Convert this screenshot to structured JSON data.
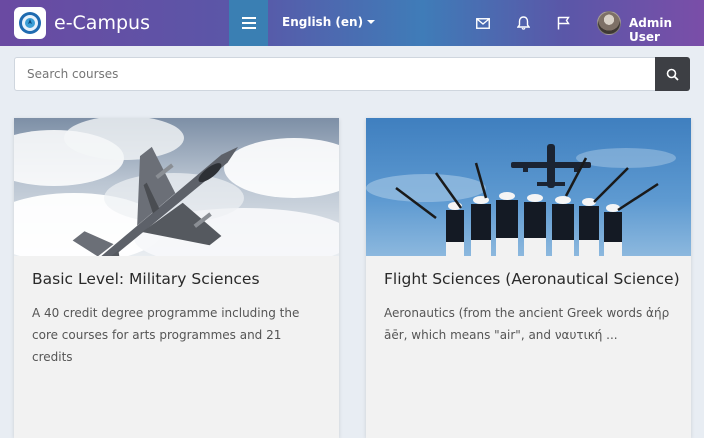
{
  "header": {
    "brand": "e-Campus",
    "language": "English (en)",
    "user_name": "Admin User",
    "icons": [
      "menu-icon",
      "mail-icon",
      "bell-icon",
      "flag-icon"
    ]
  },
  "search": {
    "placeholder": "Search courses"
  },
  "courses": [
    {
      "title": "Basic Level: Military Sciences",
      "description": "A 40 credit degree programme including the core courses for arts programmes and 21 credits"
    },
    {
      "title": "Flight Sciences (Aeronautical Science)",
      "description": "Aeronautics (from the ancient Greek words ἀήρ āēr, which means \"air\", and ναυτική ..."
    }
  ],
  "colors": {
    "menu_button": "#3a7fb3",
    "search_button": "#3d3f44",
    "card_background": "#f2f2f2"
  }
}
